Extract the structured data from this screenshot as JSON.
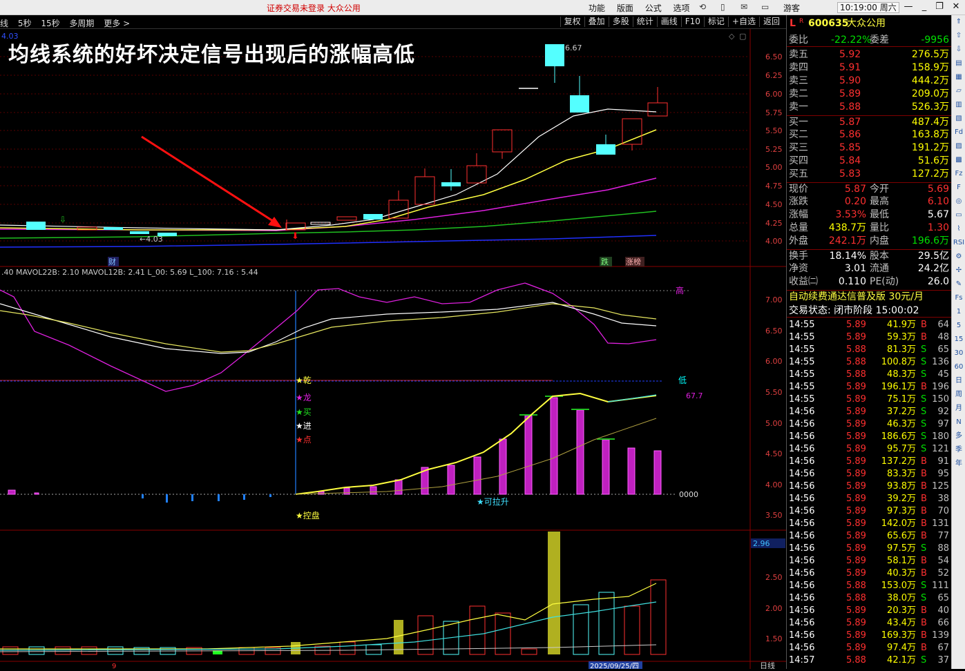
{
  "titlebar": {
    "warning": "证券交易未登录   大众公用",
    "menus": [
      "功能",
      "版面",
      "公式",
      "选项"
    ],
    "guest": "游客",
    "clock": "10:19:00 周六"
  },
  "toolbar": {
    "left": [
      "线",
      "5秒",
      "15秒",
      "多周期",
      "更多 >"
    ],
    "right": [
      "复权",
      "叠加",
      "多股",
      "统计",
      "画线",
      "F10",
      "标记",
      "+自选",
      "返回"
    ]
  },
  "overlay_title": "均线系统的好坏决定信号出现后的涨幅高低",
  "main_chart": {
    "price_axis": [
      "6.50",
      "6.25",
      "6.00",
      "5.75",
      "5.50",
      "5.25",
      "5.00",
      "4.75",
      "4.50",
      "4.25",
      "4.00"
    ],
    "high_label": "6.67",
    "low_label": "4.03",
    "top_left_value": "4.03",
    "event_tags": [
      "财",
      "跌",
      "涨榜"
    ]
  },
  "indicator": {
    "header": ".40  MAVOL22B: 2.10  MAVOL12B: 2.41  L_00: 5.69  L_100: 7.16  : 5.44",
    "axis": [
      "7.00",
      "6.50",
      "6.00",
      "5.50",
      "5.00",
      "4.50",
      "4.00",
      "3.50"
    ],
    "tag_high": "高",
    "tag_low": "低",
    "tag_val": "67.7",
    "zero_label": "0000",
    "signals": [
      "★乾",
      "★龙",
      "★买",
      "★进",
      "★点"
    ],
    "bottom_signal": "★控盘",
    "rise_signal": "★可拉升"
  },
  "volume": {
    "axis": [
      "2.50",
      "2.00",
      "1.50"
    ],
    "axis_highlight": "2.96",
    "date_label": "2025/09/25/四",
    "period_label": "日线"
  },
  "quote": {
    "code": "600635",
    "name": "大众公用",
    "ratio_label": "委比",
    "ratio_value": "-22.22%",
    "diff_label": "委差",
    "diff_value": "-9956",
    "asks": [
      {
        "label": "卖五",
        "price": "5.92",
        "vol": "276.5万"
      },
      {
        "label": "卖四",
        "price": "5.91",
        "vol": "158.9万"
      },
      {
        "label": "卖三",
        "price": "5.90",
        "vol": "444.2万"
      },
      {
        "label": "卖二",
        "price": "5.89",
        "vol": "209.0万"
      },
      {
        "label": "卖一",
        "price": "5.88",
        "vol": "526.3万"
      }
    ],
    "bids": [
      {
        "label": "买一",
        "price": "5.87",
        "vol": "487.4万"
      },
      {
        "label": "买二",
        "price": "5.86",
        "vol": "163.8万"
      },
      {
        "label": "买三",
        "price": "5.85",
        "vol": "191.2万"
      },
      {
        "label": "买四",
        "price": "5.84",
        "vol": "51.6万"
      },
      {
        "label": "买五",
        "price": "5.83",
        "vol": "127.2万"
      }
    ],
    "stats": [
      [
        "现价",
        "5.87",
        "今开",
        "5.69"
      ],
      [
        "涨跌",
        "0.20",
        "最高",
        "6.10"
      ],
      [
        "涨幅",
        "3.53%",
        "最低",
        "5.67"
      ],
      [
        "总量",
        "438.7万",
        "量比",
        "1.30"
      ],
      [
        "外盘",
        "242.1万",
        "内盘",
        "196.6万"
      ]
    ],
    "stats2": [
      [
        "换手",
        "18.14%",
        "股本",
        "29.5亿"
      ],
      [
        "净资",
        "3.01",
        "流通",
        "24.2亿"
      ],
      [
        "收益㈡",
        "0.110",
        "PE(动)",
        "26.0"
      ]
    ],
    "ad": "自动续费通达信普及版  30元/月",
    "status": "交易状态: 闭市阶段 15:00:02",
    "ticks": [
      [
        "14:55",
        "5.89",
        "41.9万",
        "B",
        "64"
      ],
      [
        "14:55",
        "5.89",
        "59.3万",
        "B",
        "48"
      ],
      [
        "14:55",
        "5.88",
        "81.3万",
        "S",
        "65"
      ],
      [
        "14:55",
        "5.88",
        "100.8万",
        "S",
        "136"
      ],
      [
        "14:55",
        "5.88",
        "48.3万",
        "S",
        "45"
      ],
      [
        "14:55",
        "5.89",
        "196.1万",
        "B",
        "196"
      ],
      [
        "14:55",
        "5.89",
        "75.1万",
        "S",
        "150"
      ],
      [
        "14:56",
        "5.89",
        "37.2万",
        "S",
        "92"
      ],
      [
        "14:56",
        "5.89",
        "46.3万",
        "S",
        "97"
      ],
      [
        "14:56",
        "5.89",
        "186.6万",
        "S",
        "180"
      ],
      [
        "14:56",
        "5.89",
        "95.7万",
        "S",
        "121"
      ],
      [
        "14:56",
        "5.89",
        "137.2万",
        "B",
        "91"
      ],
      [
        "14:56",
        "5.89",
        "83.3万",
        "B",
        "95"
      ],
      [
        "14:56",
        "5.89",
        "93.8万",
        "B",
        "125"
      ],
      [
        "14:56",
        "5.89",
        "39.2万",
        "B",
        "38"
      ],
      [
        "14:56",
        "5.89",
        "97.3万",
        "B",
        "70"
      ],
      [
        "14:56",
        "5.89",
        "142.0万",
        "B",
        "131"
      ],
      [
        "14:56",
        "5.89",
        "65.6万",
        "B",
        "77"
      ],
      [
        "14:56",
        "5.89",
        "97.5万",
        "S",
        "88"
      ],
      [
        "14:56",
        "5.89",
        "58.1万",
        "B",
        "54"
      ],
      [
        "14:56",
        "5.89",
        "40.3万",
        "B",
        "52"
      ],
      [
        "14:56",
        "5.88",
        "153.0万",
        "S",
        "111"
      ],
      [
        "14:56",
        "5.88",
        "38.0万",
        "S",
        "65"
      ],
      [
        "14:56",
        "5.89",
        "20.3万",
        "B",
        "40"
      ],
      [
        "14:56",
        "5.89",
        "43.4万",
        "B",
        "66"
      ],
      [
        "14:56",
        "5.89",
        "169.3万",
        "B",
        "139"
      ],
      [
        "14:56",
        "5.89",
        "97.4万",
        "B",
        "67"
      ],
      [
        "14:57",
        "5.88",
        "42.1万",
        "S",
        "37"
      ]
    ]
  },
  "sidebar_icons": [
    "RSI",
    "Fs",
    "1",
    "5",
    "15",
    "30",
    "60",
    "日",
    "周",
    "月",
    "N",
    "多",
    "季",
    "年"
  ]
}
